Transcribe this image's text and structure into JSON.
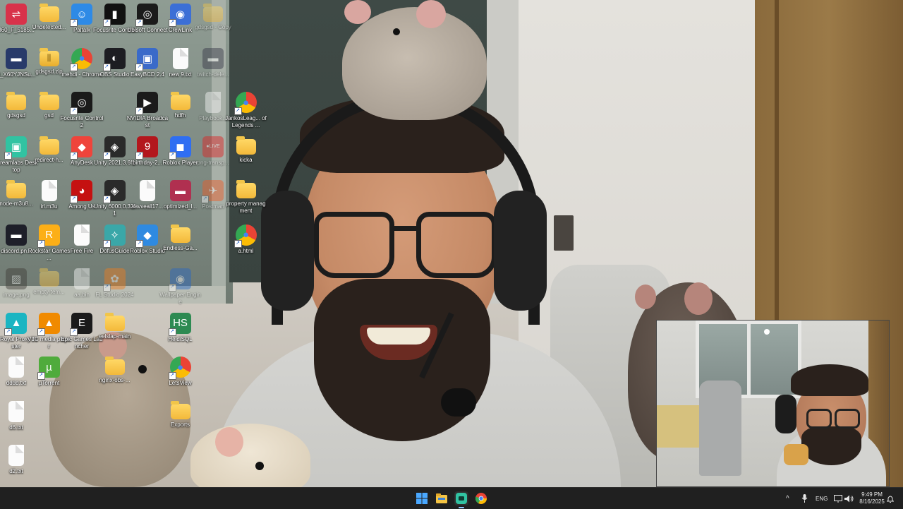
{
  "desktop": {
    "icons": [
      {
        "label": "360_F_5185...",
        "kind": "image",
        "color": "#d8324a",
        "glyph": "⇌"
      },
      {
        "label": "Undetected...",
        "kind": "folder"
      },
      {
        "label": "Paltalk",
        "kind": "app",
        "color": "#2e8ae6",
        "glyph": "☺"
      },
      {
        "label": "Focusrite Control",
        "kind": "app",
        "color": "#111111",
        "glyph": "▮"
      },
      {
        "label": "Ubisoft Connect",
        "kind": "app",
        "color": "#1b1b1b",
        "glyph": "◎"
      },
      {
        "label": "CrewLink",
        "kind": "app",
        "color": "#3c6fd6",
        "glyph": "◉"
      },
      {
        "label": "gdsgsd - Copy",
        "kind": "folder",
        "faded": true
      },
      {
        "label": "0_X60YJNSu...",
        "kind": "image",
        "color": "#283a6a",
        "glyph": "▬"
      },
      {
        "label": "gdsgsd.zip",
        "kind": "zip"
      },
      {
        "label": "mehdi - Chrome",
        "kind": "app",
        "color": "#ffffff",
        "glyph": "◍"
      },
      {
        "label": "OBS Studio",
        "kind": "app",
        "color": "#1d1d22",
        "glyph": "◐"
      },
      {
        "label": "EasyBCD 2.4",
        "kind": "app",
        "color": "#3a6ac9",
        "glyph": "▣"
      },
      {
        "label": "new 9.txt",
        "kind": "file"
      },
      {
        "label": "twitch-dele...",
        "kind": "image",
        "color": "#334",
        "glyph": "▬",
        "faded": true
      },
      {
        "label": "gdsgsd",
        "kind": "folder"
      },
      {
        "label": "gsd",
        "kind": "folder"
      },
      {
        "label": "Focusrite Control 2",
        "kind": "app",
        "color": "#1a1a1a",
        "glyph": "◎"
      },
      {
        "label": "NVIDIA Broadcast",
        "kind": "app",
        "color": "#1b1b1b",
        "glyph": "▶"
      },
      {
        "label": "hdfh",
        "kind": "folder"
      },
      {
        "label": "Playbook...",
        "kind": "file",
        "faded": true
      },
      {
        "label": "JankosLeag... of Legends ...",
        "kind": "app",
        "color": "#ffffff",
        "glyph": "◍"
      },
      {
        "label": "Streamlabs Desktop",
        "kind": "app",
        "color": "#31c3a2",
        "glyph": "▣"
      },
      {
        "label": "redirect-h...",
        "kind": "folder"
      },
      {
        "label": "AnyDesk",
        "kind": "app",
        "color": "#ef443b",
        "glyph": "◆"
      },
      {
        "label": "Unity 2021.3.6f1",
        "kind": "app",
        "color": "#2a2a2a",
        "glyph": "◈"
      },
      {
        "label": "birthday-2...",
        "kind": "app",
        "color": "#b3171d",
        "glyph": "9"
      },
      {
        "label": "Roblox Player",
        "kind": "app",
        "color": "#2f6ef2",
        "glyph": "◼"
      },
      {
        "label": "png-transp...",
        "kind": "image",
        "color": "#e02020",
        "glyph": "●LIVE",
        "faded": true
      },
      {
        "label": "kicka",
        "kind": "folder"
      },
      {
        "label": "node-m3u8...",
        "kind": "folder"
      },
      {
        "label": "irl.m3u",
        "kind": "file"
      },
      {
        "label": "Among Us",
        "kind": "app",
        "color": "#c51111",
        "glyph": "◕"
      },
      {
        "label": "Unity 6000.0.32f1",
        "kind": "app",
        "color": "#2a2a2a",
        "glyph": "◈"
      },
      {
        "label": "savveall17...",
        "kind": "file"
      },
      {
        "label": "optimized_l...",
        "kind": "image",
        "color": "#b03050",
        "glyph": "▬"
      },
      {
        "label": "Postman",
        "kind": "app",
        "color": "#ef5b25",
        "glyph": "✈",
        "faded": true
      },
      {
        "label": "property managment",
        "kind": "folder"
      },
      {
        "label": "discord.pn...",
        "kind": "image",
        "color": "#1e1f29",
        "glyph": "▬"
      },
      {
        "label": "Rockstar Games ...",
        "kind": "app",
        "color": "#fcaf17",
        "glyph": "R"
      },
      {
        "label": "Free Fire",
        "kind": "file"
      },
      {
        "label": "DofusGuide",
        "kind": "app",
        "color": "#3aa7a8",
        "glyph": "✧"
      },
      {
        "label": "Roblox Studio",
        "kind": "app",
        "color": "#2f8ae0",
        "glyph": "◆"
      },
      {
        "label": "Endless-Ga...",
        "kind": "folder"
      },
      {
        "label": "a.html",
        "kind": "app",
        "color": "#ffffff",
        "glyph": "◍"
      },
      {
        "label": "image.png",
        "kind": "image",
        "color": "#3d3a35",
        "glyph": "▨",
        "faded": true
      },
      {
        "label": "empty-tem...",
        "kind": "folder",
        "faded": true
      },
      {
        "label": "aa.bin",
        "kind": "file",
        "faded": true
      },
      {
        "label": "FL Studio 2024",
        "kind": "app",
        "color": "#f07c1a",
        "glyph": "✿",
        "faded": true
      },
      {
        "label": "Wallpaper Engine",
        "kind": "app",
        "color": "#2767c4",
        "glyph": "◉",
        "faded": true
      },
      {
        "label": "IPRoyal Proxy Tester",
        "kind": "app",
        "color": "#1bb5c2",
        "glyph": "▲"
      },
      {
        "label": "VLC media player",
        "kind": "app",
        "color": "#f08a00",
        "glyph": "▲"
      },
      {
        "label": "Epic Games Launcher",
        "kind": "app",
        "color": "#1b1b1b",
        "glyph": "E"
      },
      {
        "label": "eelslap-main",
        "kind": "folder"
      },
      {
        "label": "HeidiSQL",
        "kind": "app",
        "color": "#2d8a52",
        "glyph": "HS"
      },
      {
        "label": "dddd.txt",
        "kind": "file"
      },
      {
        "label": "µTorrent",
        "kind": "app",
        "color": "#4fab3c",
        "glyph": "µ"
      },
      {
        "label": "nginx-obs-...",
        "kind": "folder"
      },
      {
        "label": "LetsView",
        "kind": "app",
        "color": "#ffffff",
        "glyph": "◈"
      },
      {
        "label": "d6.txt",
        "kind": "file"
      },
      {
        "label": "Exports",
        "kind": "folder"
      },
      {
        "label": "d2.txt",
        "kind": "file"
      }
    ]
  },
  "taskbar": {
    "apps": [
      {
        "name": "windows-start-icon",
        "color": "#4aa8ff"
      },
      {
        "name": "file-explorer-icon",
        "color": "#f6c544"
      },
      {
        "name": "streamlabs-taskbar-icon",
        "color": "#31c3a2"
      },
      {
        "name": "chrome-taskbar-icon",
        "color": "#ea4335"
      }
    ],
    "tray": {
      "chevron": "^",
      "lang": "ENG",
      "time": "9:49 PM",
      "date": "8/16/2025"
    }
  }
}
